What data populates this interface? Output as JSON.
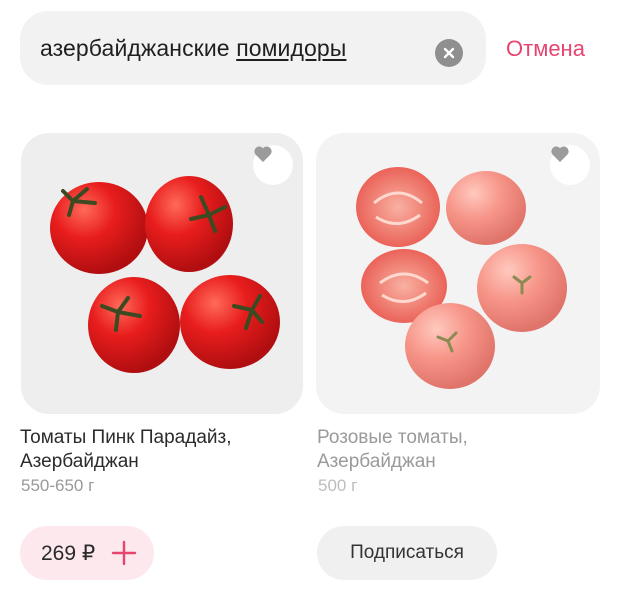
{
  "search": {
    "query_plain": "азербайджанские ",
    "query_underlined": "помидоры",
    "cancel_label": "Отмена"
  },
  "products": [
    {
      "title_line1": "Томаты Пинк Парадайз,",
      "title_line2": "Азербайджан",
      "weight": "550-650 г",
      "price": "269 ₽"
    },
    {
      "title_line1": "Розовые томаты,",
      "title_line2": "Азербайджан",
      "weight": "500 г",
      "subscribe_label": "Подписаться"
    }
  ],
  "colors": {
    "accent": "#e5456f",
    "price_bg": "#fde8ee",
    "search_bg": "#f2f2f2"
  },
  "icons": [
    "clear-icon",
    "heart-icon",
    "plus-icon"
  ]
}
